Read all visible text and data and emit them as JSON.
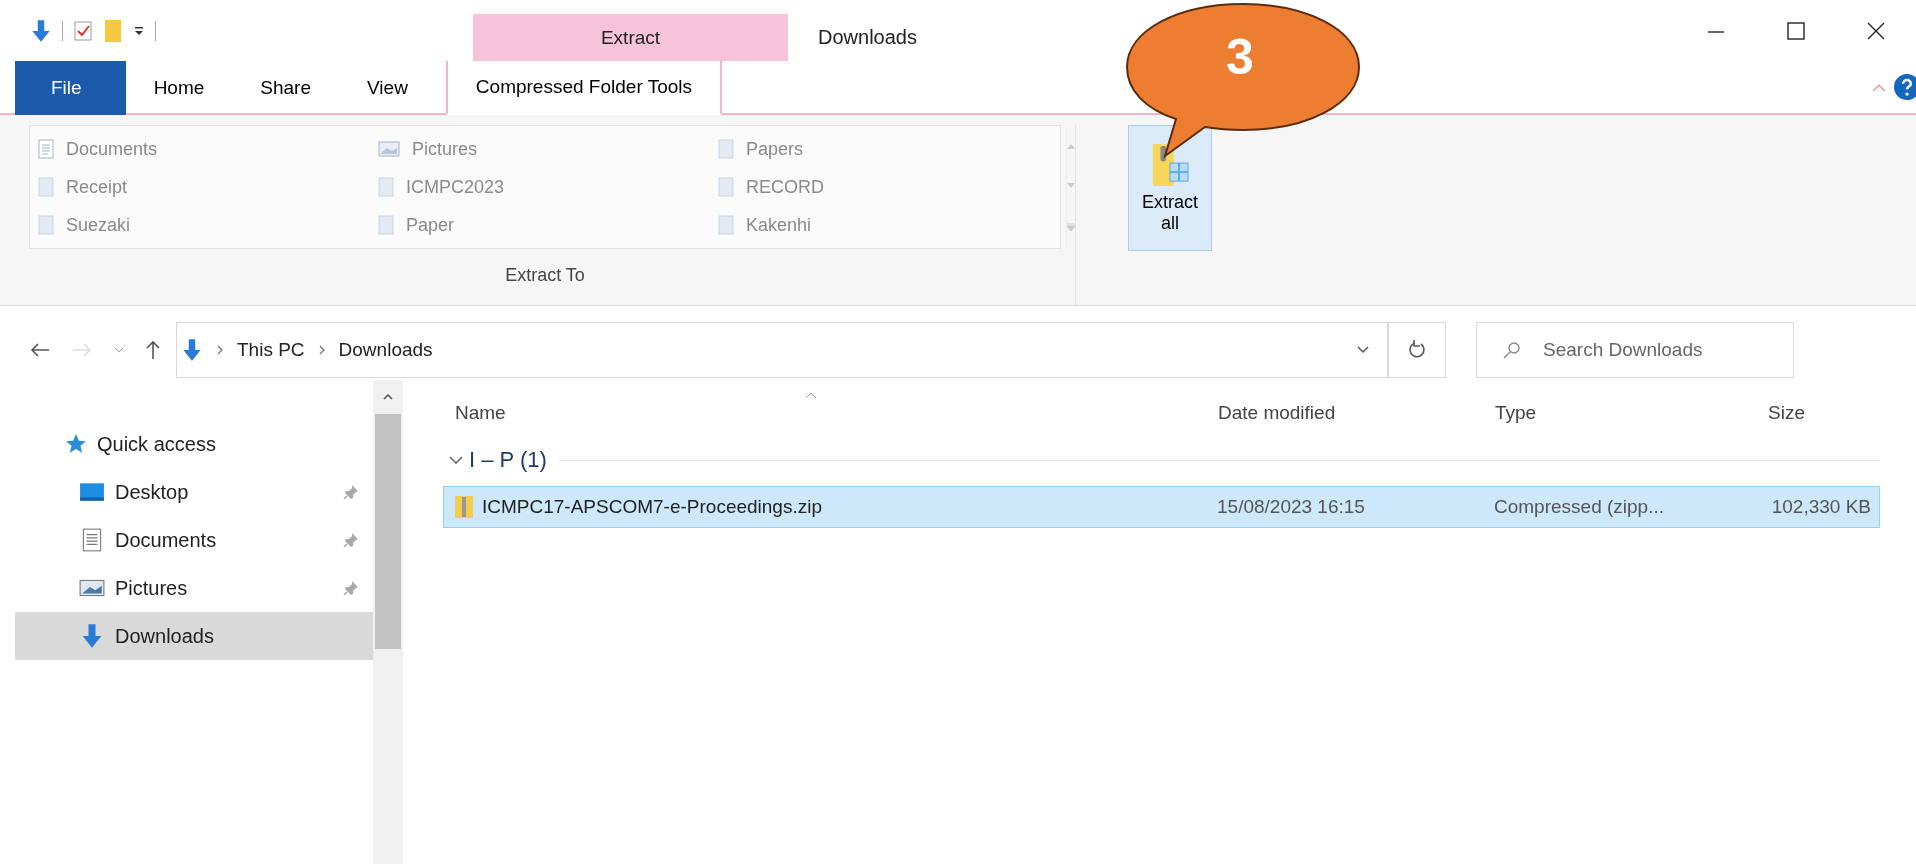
{
  "contextual_group": "Extract",
  "window_title": "Downloads",
  "ribbon_tabs": [
    {
      "label": "File",
      "kind": "file",
      "selected": false
    },
    {
      "label": "Home",
      "kind": "tab",
      "selected": false
    },
    {
      "label": "Share",
      "kind": "tab",
      "selected": false
    },
    {
      "label": "View",
      "kind": "tab",
      "selected": false
    },
    {
      "label": "Compressed Folder Tools",
      "kind": "tab",
      "selected": true
    }
  ],
  "extract_to": {
    "columns": [
      [
        {
          "label": "Documents",
          "kind": "documents"
        },
        {
          "label": "Receipt",
          "kind": "folder"
        },
        {
          "label": "Suezaki",
          "kind": "folder"
        }
      ],
      [
        {
          "label": "Pictures",
          "kind": "pictures"
        },
        {
          "label": "ICMPC2023",
          "kind": "folder"
        },
        {
          "label": "Paper",
          "kind": "folder"
        }
      ],
      [
        {
          "label": "Papers",
          "kind": "folder"
        },
        {
          "label": "RECORD",
          "kind": "folder"
        },
        {
          "label": "Kakenhi",
          "kind": "folder"
        }
      ]
    ],
    "group_label": "Extract To"
  },
  "extract_all_button": "Extract all",
  "address": {
    "path": [
      "This PC",
      "Downloads"
    ]
  },
  "search": {
    "placeholder": "Search Downloads"
  },
  "navigation": [
    {
      "label": "Quick access",
      "kind": "star",
      "selected": false,
      "children": [
        {
          "label": "Desktop",
          "kind": "desktop",
          "pinned": true,
          "selected": false
        },
        {
          "label": "Documents",
          "kind": "documents",
          "pinned": true,
          "selected": false
        },
        {
          "label": "Pictures",
          "kind": "pictures",
          "pinned": true,
          "selected": false
        },
        {
          "label": "Downloads",
          "kind": "downloads",
          "pinned": false,
          "selected": true
        }
      ]
    }
  ],
  "columns": [
    "Name",
    "Date modified",
    "Type",
    "Size"
  ],
  "groups": [
    {
      "label": "I – P (1)",
      "expanded": true,
      "rows": [
        {
          "name": "ICMPC17-APSCOM7-e-Proceedings.zip",
          "date_modified": "15/08/2023 16:15",
          "type": "Compressed (zipp...",
          "size": "102,330 KB",
          "selected": true
        }
      ]
    }
  ],
  "callout": "3"
}
